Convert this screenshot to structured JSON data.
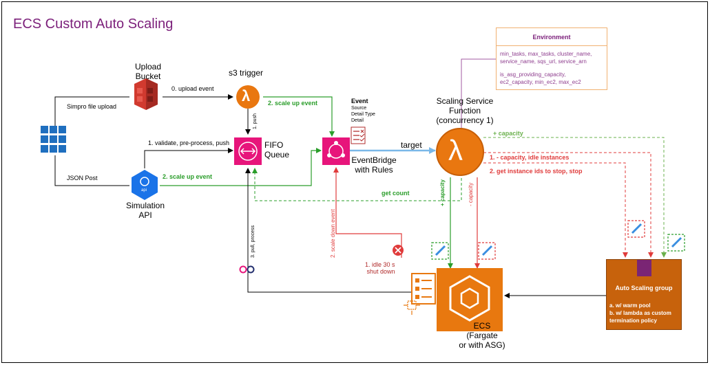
{
  "title": "ECS Custom Auto Scaling",
  "nodes": {
    "upload_bucket": "Upload\nBucket",
    "s3_trigger": "s3 trigger",
    "fifo_queue": "FIFO\nQueue",
    "event_header": "Event",
    "event_fields": [
      "Source",
      "Detail Type",
      "Detail"
    ],
    "eventbridge": "EventBridge\nwith Rules",
    "scaling_function": "Scaling Service\nFunction\n(concurrency 1)",
    "simulation_api": "Simulation\nAPI",
    "api_badge": "api",
    "ecs": "ECS\n(Fargate\nor with ASG)",
    "lambda_glyph": "λ"
  },
  "environment": {
    "title": "Environment",
    "lines": [
      "min_tasks, max_tasks, cluster_name,",
      "service_name, sqs_url, service_arn",
      "is_asg_providing_capacity,",
      "ec2_capacity, min_ec2, max_ec2"
    ]
  },
  "asg": {
    "title": "Auto Scaling group",
    "notes": [
      "a. w/ warm pool",
      "b. w/ lambda as custom",
      "termination policy"
    ]
  },
  "edges": {
    "upload_event": "0. upload event",
    "simpro_upload": "Simpro file upload",
    "push": "1. push",
    "validate": "1. validate, pre-process, push",
    "json_post": "JSON Post",
    "scale_up_event_top": "2. scale up event",
    "scale_up_event_api": "2. scale up event",
    "target": "target",
    "plus_capacity_top": "+ capacity",
    "minus_capacity_idle": "1. - capacity, idle instances",
    "get_instance_ids": "2. get instance ids to stop, stop",
    "get_count": "get count",
    "plus_capacity_vertical": "+ capacity",
    "minus_capacity_vertical": "- capacity",
    "scale_down_event": "2. scale down event",
    "pull_process": "3. pull, process",
    "idle_shutdown": "1. idle 30 s\nshut down"
  },
  "colors": {
    "title": "#7b1f7a",
    "green_flow": "#2a9d2a",
    "red_flow": "#e03b3b",
    "aws_orange": "#e8780f",
    "aws_pink": "#e7157b",
    "lambda_orange": "#e97710",
    "s3_red": "#d13a2f",
    "asg_fill": "#c7620c",
    "api_blue": "#1a73e8"
  }
}
